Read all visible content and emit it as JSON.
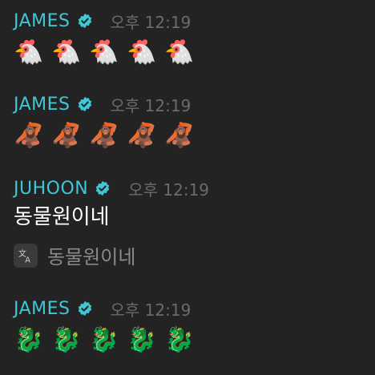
{
  "messages": [
    {
      "author": "JAMES",
      "time": "오후 12:19",
      "emojis": [
        "🐔",
        "🐔",
        "🐔",
        "🐔",
        "🐔"
      ]
    },
    {
      "author": "JAMES",
      "time": "오후 12:19",
      "emojis": [
        "🦧",
        "🦧",
        "🦧",
        "🦧",
        "🦧"
      ]
    },
    {
      "author": "JUHOON",
      "time": "오후 12:19",
      "text": "동물원이네",
      "translation": "동물원이네"
    },
    {
      "author": "JAMES",
      "time": "오후 12:19",
      "emojis": [
        "🐉",
        "🐉",
        "🐉",
        "🐉",
        "🐉"
      ]
    }
  ],
  "colors": {
    "background": "#232323",
    "author": "#3fc7d6",
    "verified": "#3fc7d6",
    "time": "#6b6b6b"
  },
  "icons": {
    "verified": "verified-badge-icon",
    "translate": "translate-icon"
  }
}
